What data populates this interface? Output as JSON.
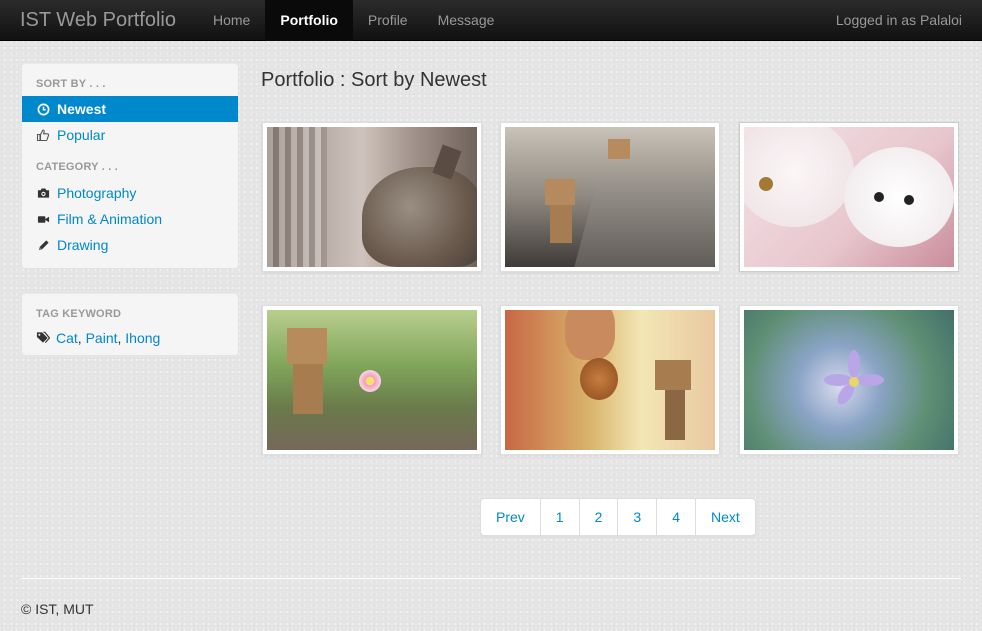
{
  "navbar": {
    "brand": "IST Web Portfolio",
    "items": [
      {
        "label": "Home",
        "active": false
      },
      {
        "label": "Portfolio",
        "active": true
      },
      {
        "label": "Profile",
        "active": false
      },
      {
        "label": "Message",
        "active": false
      }
    ],
    "user_status": "Logged in as Palaloi"
  },
  "sidebar": {
    "sort_header": "SORT BY . . .",
    "sort_items": [
      {
        "label": "Newest",
        "icon": "clock-icon",
        "active": true
      },
      {
        "label": "Popular",
        "icon": "thumbs-up-icon",
        "active": false
      }
    ],
    "category_header": "CATEGORY . . .",
    "category_items": [
      {
        "label": "Photography",
        "icon": "camera-icon"
      },
      {
        "label": "Film & Animation",
        "icon": "video-camera-icon"
      },
      {
        "label": "Drawing",
        "icon": "pencil-icon"
      }
    ],
    "tag_header": "TAG KEYWORD",
    "tag_icon": "tags-icon",
    "tags": [
      "Cat",
      "Paint",
      "Ihong"
    ],
    "tag_separator": ", "
  },
  "main": {
    "title": "Portfolio : Sort by Newest",
    "thumbnails": [
      {
        "subject": "tabby cat by window"
      },
      {
        "subject": "cardboard robot climbing wall"
      },
      {
        "subject": "two white kittens"
      },
      {
        "subject": "cardboard robot holding flower"
      },
      {
        "subject": "cardboard robot with cookie"
      },
      {
        "subject": "purple flower"
      }
    ]
  },
  "pagination": {
    "prev": "Prev",
    "pages": [
      "1",
      "2",
      "3",
      "4"
    ],
    "next": "Next"
  },
  "footer": {
    "text": "© IST, MUT"
  },
  "colors": {
    "link": "#0088cc",
    "navbar": "#1b1b1b",
    "background": "#e6e6e6"
  }
}
